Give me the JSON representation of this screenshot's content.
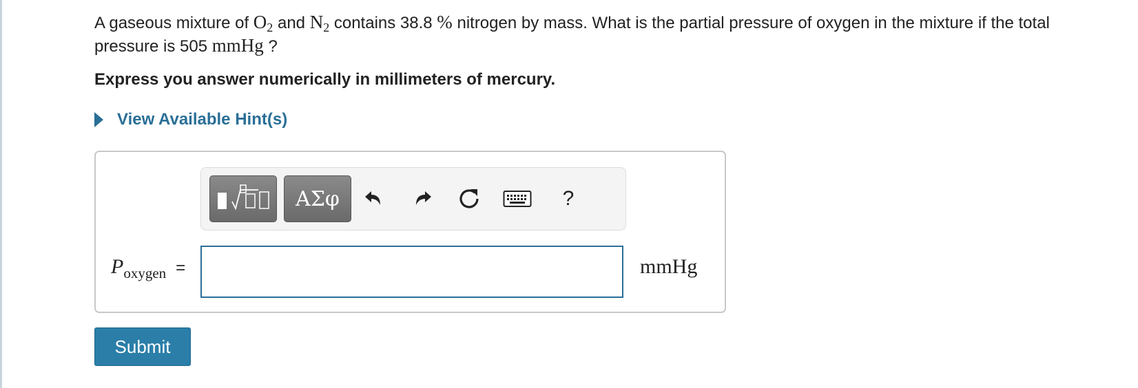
{
  "question": {
    "part1": "A gaseous mixture of ",
    "o2": "O",
    "o2_sub": "2",
    "part2": " and ",
    "n2": "N",
    "n2_sub": "2",
    "part3": " contains 38.8 ",
    "percent": "%",
    "part4": " nitrogen by mass. What is the partial pressure of oxygen in the mixture if the total pressure is 505 ",
    "unit": "mmHg",
    "part5": " ?"
  },
  "instruction": "Express you answer numerically in millimeters of mercury.",
  "hint": {
    "label": "View Available Hint(s)"
  },
  "toolbar": {
    "greek_label": "ΑΣφ",
    "help_label": "?",
    "icons": [
      "templates-icon",
      "greek-letters-icon",
      "undo-icon",
      "redo-icon",
      "reset-icon",
      "keyboard-icon",
      "help-icon"
    ]
  },
  "answer": {
    "label_var": "P",
    "label_sub": "oxygen",
    "equals": "=",
    "value": "",
    "unit": "mmHg"
  },
  "submit_label": "Submit",
  "colors": {
    "accent": "#2a6f97",
    "button": "#2a7ea8",
    "toolbar_button": "#6f6f6f"
  }
}
